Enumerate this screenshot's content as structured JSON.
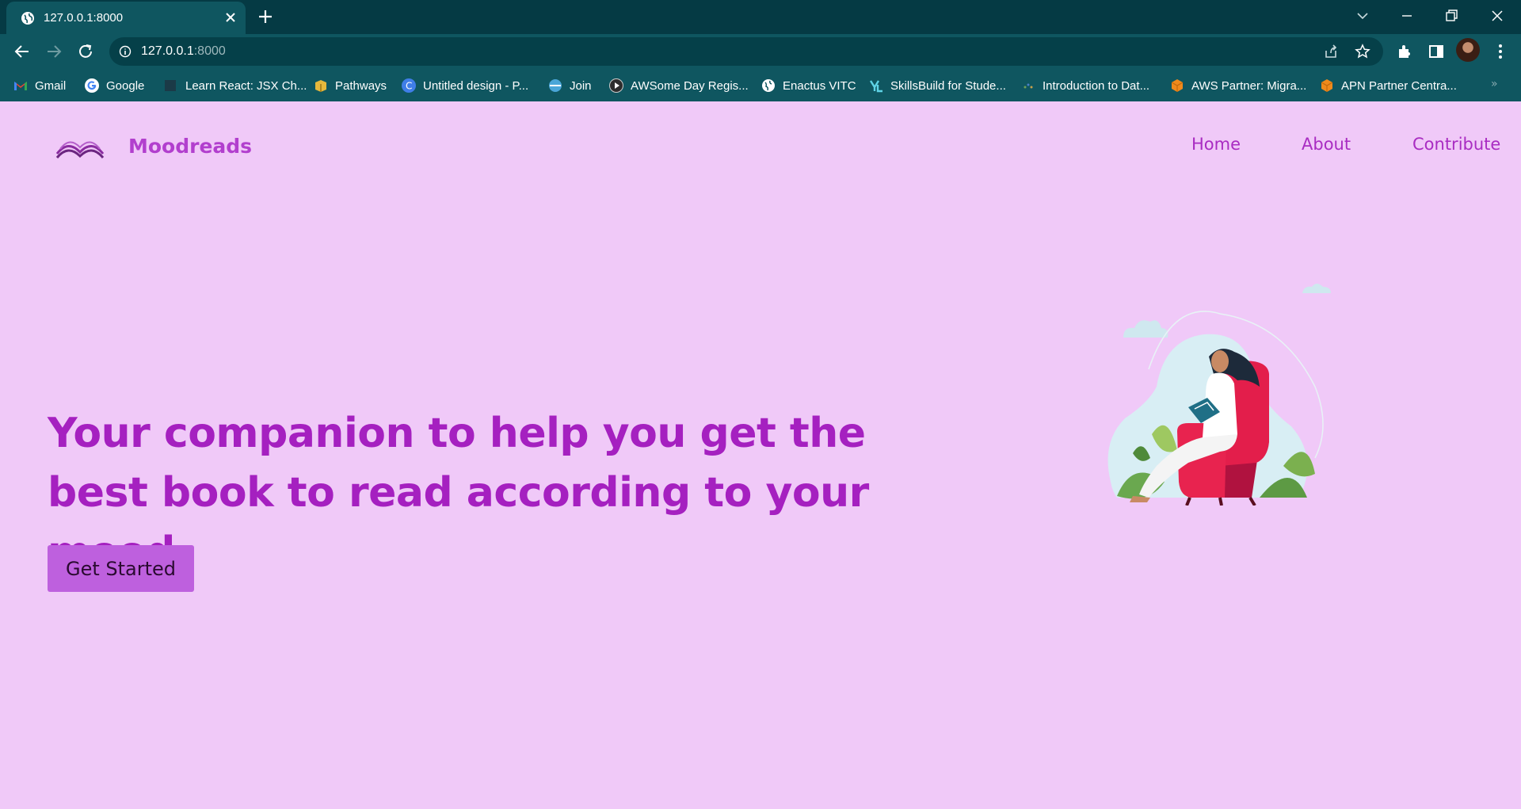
{
  "browser": {
    "tab_title": "127.0.0.1:8000",
    "url_host": "127.0.0.1",
    "url_port": ":8000",
    "bookmarks": [
      {
        "label": "Gmail",
        "icon": "gmail-icon"
      },
      {
        "label": "Google",
        "icon": "google-icon"
      },
      {
        "label": "Learn React: JSX Ch...",
        "icon": "codecademy-icon"
      },
      {
        "label": "Pathways",
        "icon": "box-icon"
      },
      {
        "label": "Untitled design - P...",
        "icon": "canva-icon"
      },
      {
        "label": "Join",
        "icon": "webex-icon"
      },
      {
        "label": "AWSome Day Regis...",
        "icon": "play-icon"
      },
      {
        "label": "Enactus VITC",
        "icon": "globe-icon"
      },
      {
        "label": "SkillsBuild for Stude...",
        "icon": "skillsbuild-icon"
      },
      {
        "label": "Introduction to Dat...",
        "icon": "course-icon"
      },
      {
        "label": "AWS Partner: Migra...",
        "icon": "aws-icon"
      },
      {
        "label": "APN Partner Centra...",
        "icon": "aws-icon"
      }
    ]
  },
  "site": {
    "brand": "Moodreads",
    "nav": {
      "home": "Home",
      "about": "About",
      "contribute": "Contribute"
    }
  },
  "hero": {
    "heading": "Your companion to help you get the best book to read according to your mood.",
    "cta": "Get Started"
  },
  "colors": {
    "page_bg": "#f0c9f8",
    "accent": "#b23fce",
    "heading": "#a520c0",
    "button": "#be60de",
    "chrome": "#0f5660"
  }
}
